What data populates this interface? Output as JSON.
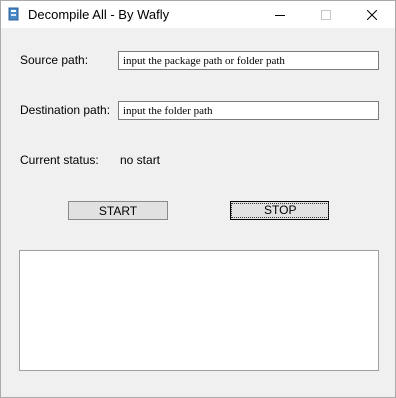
{
  "window": {
    "title": "Decompile All - By Wafly"
  },
  "form": {
    "source_label": "Source path:",
    "source_value": "input the package path or folder path",
    "destination_label": "Destination path:",
    "destination_value": "input the folder path",
    "status_label": "Current status:",
    "status_value": "no start"
  },
  "buttons": {
    "start": "START",
    "stop": "STOP"
  },
  "icons": [
    "app-icon",
    "minimize-icon",
    "maximize-icon",
    "close-icon"
  ]
}
